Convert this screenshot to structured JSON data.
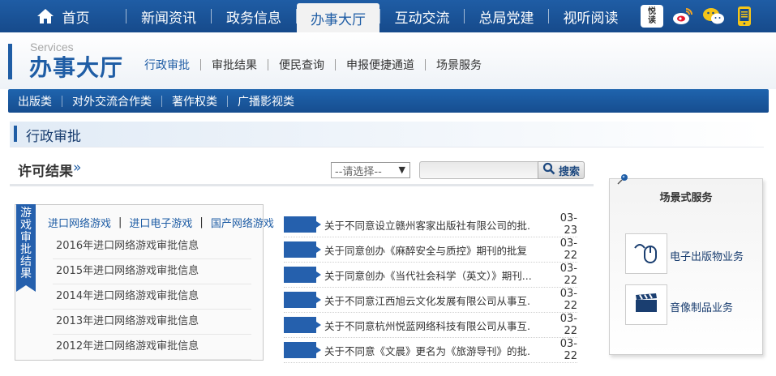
{
  "topnav": {
    "home": "首页",
    "items": [
      "新闻资讯",
      "政务信息",
      "办事大厅",
      "互动交流",
      "总局党建",
      "视听阅读"
    ],
    "active": "办事大厅",
    "icons": [
      "yuedu-app-icon",
      "weibo-icon",
      "wechat-icon",
      "mobile-icon"
    ],
    "yuedu_text": "悦读"
  },
  "header": {
    "brand_en": "Services",
    "brand_cn": "办事大厅",
    "subnav": [
      "行政审批",
      "审批结果",
      "便民查询",
      "申报便捷通道",
      "场景服务"
    ]
  },
  "catbar": [
    "出版类",
    "对外交流合作类",
    "著作权类",
    "广播影视类"
  ],
  "section": {
    "title": "行政审批"
  },
  "permit": {
    "title": "许可结果",
    "arrow": "»",
    "select_value": "--请选择--",
    "search_placeholder": "",
    "search_label": "搜索"
  },
  "games": {
    "ribbon": [
      "游",
      "戏",
      "审",
      "批",
      "结",
      "果"
    ],
    "tabs": [
      "进口网络游戏",
      "进口电子游戏",
      "国产网络游戏"
    ],
    "tab_sep": "|",
    "items": [
      "2016年进口网络游戏审批信息",
      "2015年进口网络游戏审批信息",
      "2014年进口网络游戏审批信息",
      "2013年进口网络游戏审批信息",
      "2012年进口网络游戏审批信息"
    ]
  },
  "news": [
    {
      "title": "关于不同意设立赣州客家出版社有限公司的批...",
      "date": "03-23"
    },
    {
      "title": "关于同意创办《麻醉安全与质控》期刊的批复",
      "date": "03-22"
    },
    {
      "title": "关于同意创办《当代社会科学（英文）》期刊...",
      "date": "03-22"
    },
    {
      "title": "关于不同意江西旭云文化发展有限公司从事互...",
      "date": "03-22"
    },
    {
      "title": "关于不同意杭州悦蓝网络科技有限公司从事互...",
      "date": "03-22"
    },
    {
      "title": "关于不同意《文晨》更名为《旅游导刊》的批...",
      "date": "03-22"
    }
  ],
  "scene": {
    "title": "场景式服务",
    "services": [
      {
        "label": "电子出版物业务",
        "icon": "mouse-icon"
      },
      {
        "label": "音像制品业务",
        "icon": "clapperboard-icon"
      }
    ]
  },
  "colors": {
    "brand_blue": "#1f5da5",
    "tag_blue": "#2560ad"
  }
}
